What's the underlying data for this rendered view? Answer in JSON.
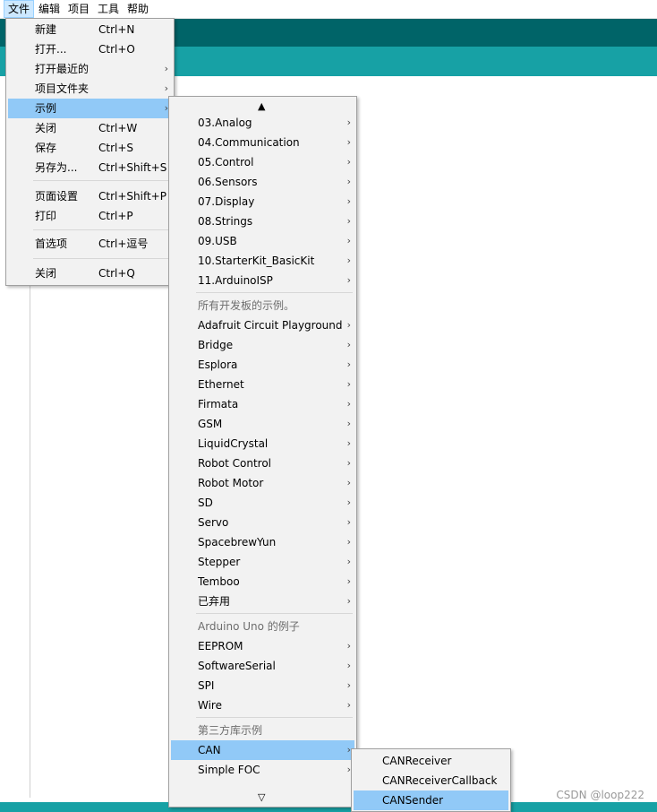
{
  "menubar": [
    "文件",
    "编辑",
    "项目",
    "工具",
    "帮助"
  ],
  "file_menu": [
    {
      "label": "新建",
      "shortcut": "Ctrl+N"
    },
    {
      "label": "打开...",
      "shortcut": "Ctrl+O"
    },
    {
      "label": "打开最近的",
      "shortcut": "",
      "submenu": true
    },
    {
      "label": "项目文件夹",
      "shortcut": "",
      "submenu": true
    },
    {
      "label": "示例",
      "shortcut": "",
      "submenu": true,
      "highlighted": true
    },
    {
      "label": "关闭",
      "shortcut": "Ctrl+W"
    },
    {
      "label": "保存",
      "shortcut": "Ctrl+S"
    },
    {
      "label": "另存为...",
      "shortcut": "Ctrl+Shift+S"
    },
    {
      "label": "页面设置",
      "shortcut": "Ctrl+Shift+P"
    },
    {
      "label": "打印",
      "shortcut": "Ctrl+P"
    },
    {
      "label": "首选项",
      "shortcut": "Ctrl+逗号"
    },
    {
      "label": "关闭",
      "shortcut": "Ctrl+Q"
    }
  ],
  "examples_menu": {
    "scroll_up": "▲",
    "scroll_down": "▽",
    "builtin": [
      "03.Analog",
      "04.Communication",
      "05.Control",
      "06.Sensors",
      "07.Display",
      "08.Strings",
      "09.USB",
      "10.StarterKit_BasicKit",
      "11.ArduinoISP"
    ],
    "all_boards_header": "所有开发板的示例。",
    "all_boards": [
      "Adafruit Circuit Playground",
      "Bridge",
      "Esplora",
      "Ethernet",
      "Firmata",
      "GSM",
      "LiquidCrystal",
      "Robot Control",
      "Robot Motor",
      "SD",
      "Servo",
      "SpacebrewYun",
      "Stepper",
      "Temboo",
      "已弃用"
    ],
    "uno_header": "Arduino Uno 的例子",
    "uno": [
      "EEPROM",
      "SoftwareSerial",
      "SPI",
      "Wire"
    ],
    "third_party_header": "第三方库示例",
    "third_party": [
      "CAN",
      "Simple FOC"
    ]
  },
  "can_menu": [
    "CANReceiver",
    "CANReceiverCallback",
    "CANSender"
  ],
  "watermark": "CSDN @loop222",
  "colors": {
    "toolbar": "#006468",
    "tabbar": "#17a1a5",
    "highlight": "#91c9f7"
  }
}
